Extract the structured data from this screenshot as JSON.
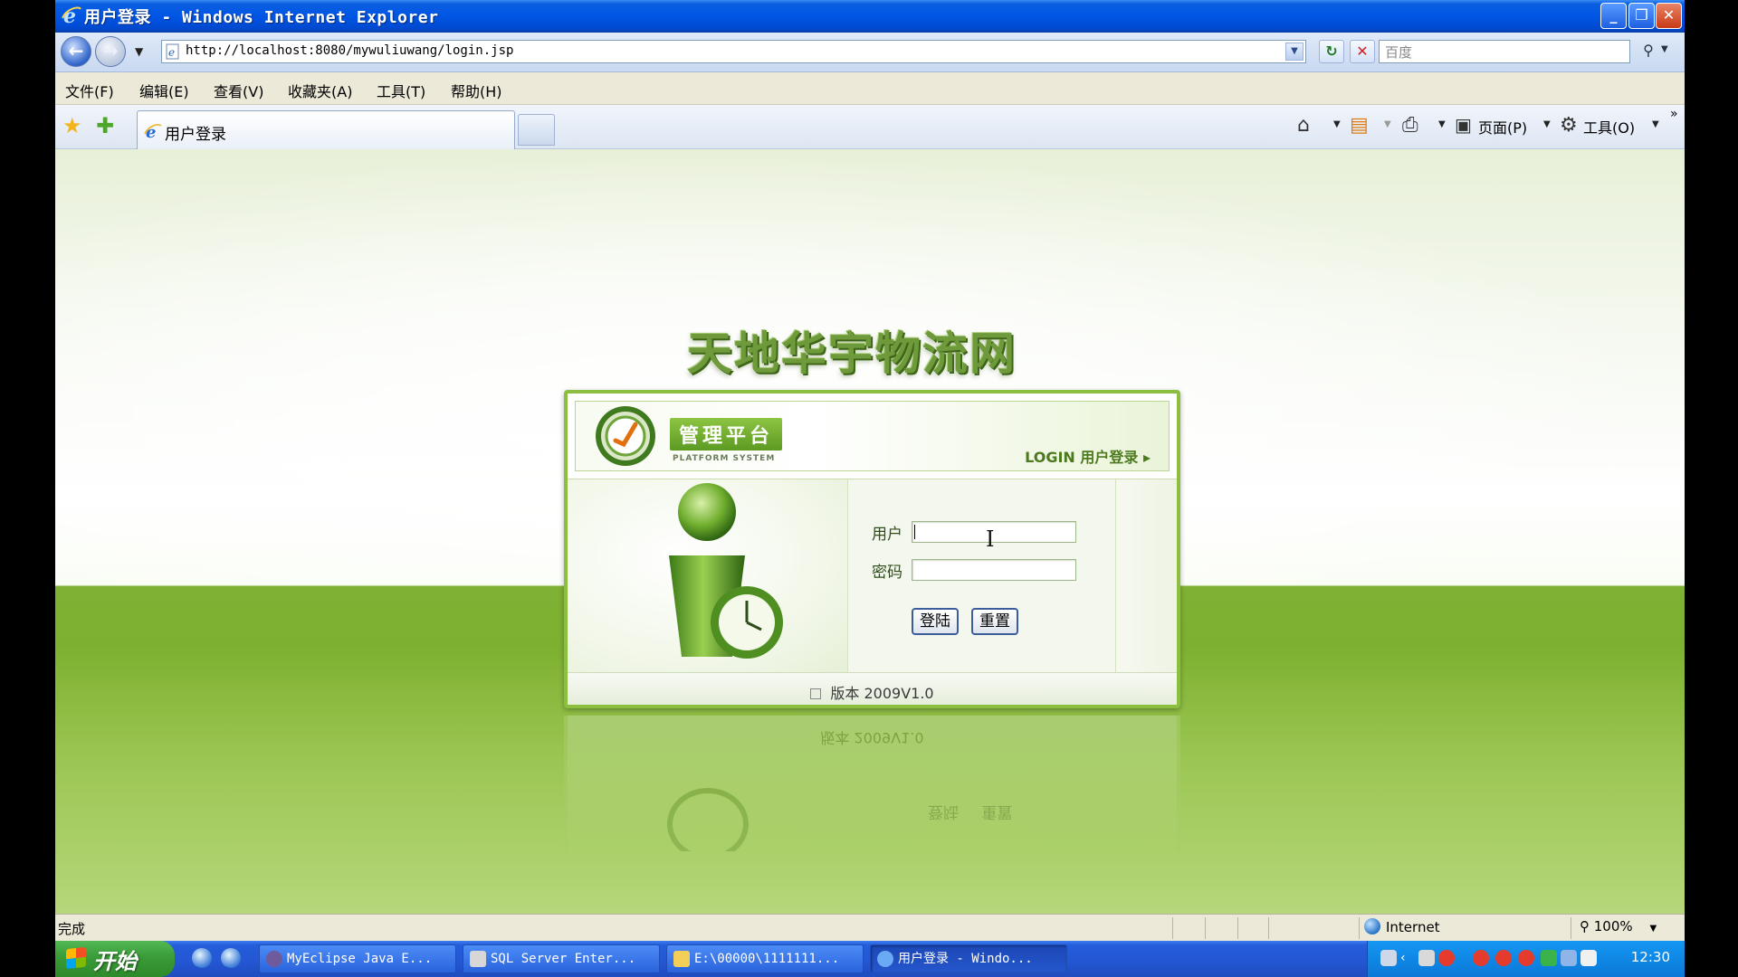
{
  "window": {
    "title": "用户登录 - Windows Internet Explorer"
  },
  "address_bar": {
    "url": "http://localhost:8080/mywuliuwang/login.jsp",
    "search_placeholder": "百度"
  },
  "menu": {
    "items": [
      "文件(F)",
      "编辑(E)",
      "查看(V)",
      "收藏夹(A)",
      "工具(T)",
      "帮助(H)"
    ]
  },
  "tab": {
    "label": "用户登录"
  },
  "command_bar": {
    "page_label": "页面(P)",
    "tools_label": "工具(O)"
  },
  "page": {
    "site_title": "天地华宇物流网",
    "panel_badge": "管理平台",
    "panel_subtitle": "PLATFORM SYSTEM",
    "login_link": "LOGIN 用户登录",
    "user_label": "用户",
    "password_label": "密码",
    "user_value": "",
    "password_value": "",
    "login_button": "登陆",
    "reset_button": "重置",
    "version": "版本 2009V1.0"
  },
  "status_bar": {
    "status": "完成",
    "zone": "Internet",
    "zoom": "100%"
  },
  "taskbar": {
    "start_label": "开始",
    "tasks": [
      "MyEclipse Java E...",
      "SQL Server Enter...",
      "E:\\00000\\1111111...",
      "用户登录 - Windo..."
    ],
    "clock": "12:30"
  },
  "colors": {
    "titlebar": "#0055e5",
    "page_green": "#7fb134",
    "panel_border": "#8cbf40",
    "title_green": "#6e9a3c"
  }
}
